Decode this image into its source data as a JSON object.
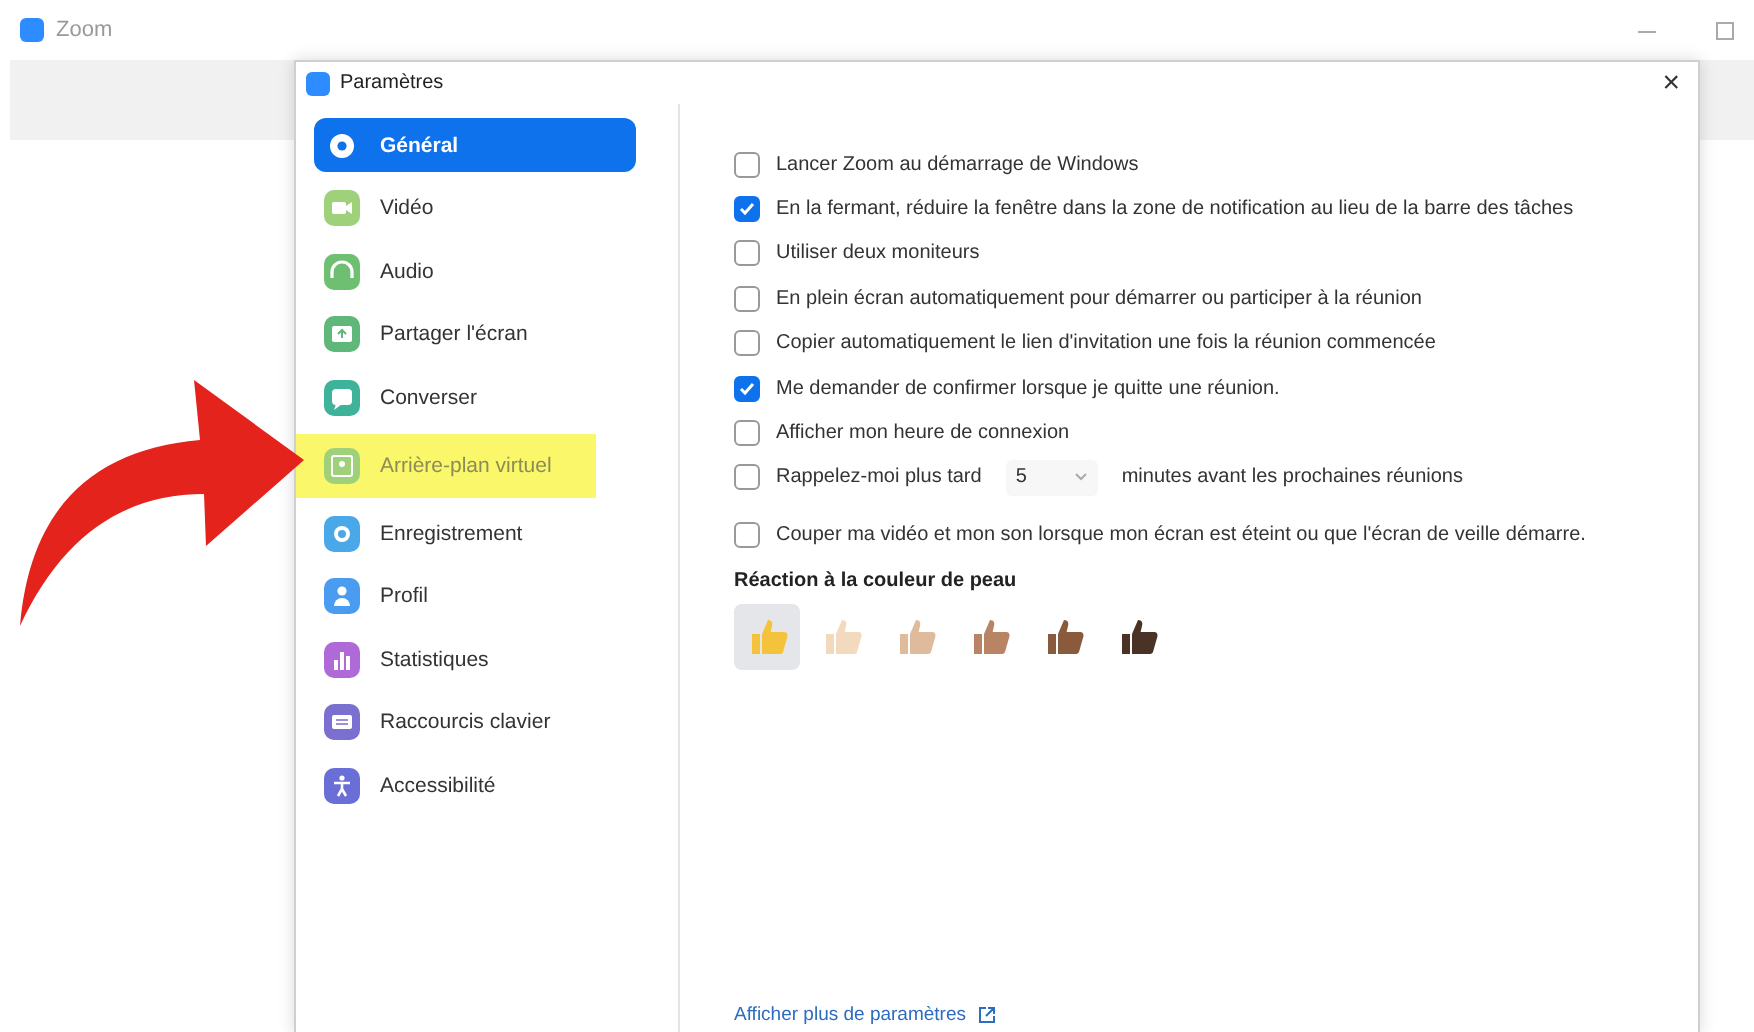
{
  "app_window": {
    "title": "Zoom"
  },
  "dialog": {
    "title": "Paramètres",
    "close": "×"
  },
  "sidebar": {
    "items": [
      {
        "label": "Général",
        "selected": true,
        "highlighted": false
      },
      {
        "label": "Vidéo",
        "selected": false,
        "highlighted": false
      },
      {
        "label": "Audio",
        "selected": false,
        "highlighted": false
      },
      {
        "label": "Partager l'écran",
        "selected": false,
        "highlighted": false
      },
      {
        "label": "Converser",
        "selected": false,
        "highlighted": false
      },
      {
        "label": "Arrière-plan virtuel",
        "selected": false,
        "highlighted": true
      },
      {
        "label": "Enregistrement",
        "selected": false,
        "highlighted": false
      },
      {
        "label": "Profil",
        "selected": false,
        "highlighted": false
      },
      {
        "label": "Statistiques",
        "selected": false,
        "highlighted": false
      },
      {
        "label": "Raccourcis clavier",
        "selected": false,
        "highlighted": false
      },
      {
        "label": "Accessibilité",
        "selected": false,
        "highlighted": false
      }
    ]
  },
  "options": [
    {
      "kind": "checkbox",
      "label": "Lancer Zoom au démarrage de Windows",
      "checked": false
    },
    {
      "kind": "checkbox",
      "label": "En la fermant, réduire la fenêtre dans la zone de notification au lieu de la barre des tâches",
      "checked": true
    },
    {
      "kind": "checkbox",
      "label": "Utiliser deux moniteurs",
      "checked": false
    },
    {
      "kind": "checkbox",
      "label": "En plein écran automatiquement pour démarrer ou participer à la réunion",
      "checked": false
    },
    {
      "kind": "checkbox",
      "label": "Copier automatiquement le lien d'invitation une fois la réunion commencée",
      "checked": false
    },
    {
      "kind": "checkbox",
      "label": "Me demander de confirmer lorsque je quitte une réunion.",
      "checked": true
    },
    {
      "kind": "checkbox",
      "label": "Afficher mon heure de connexion",
      "checked": false
    },
    {
      "kind": "reminder",
      "label": "Rappelez-moi plus tard",
      "checked": false,
      "value": "5",
      "suffix": "minutes avant les prochaines réunions"
    },
    {
      "kind": "checkbox_spaced",
      "label": "Couper ma vidéo et mon son lorsque mon écran est éteint ou que l'écran de veille démarre.",
      "checked": false
    }
  ],
  "skin_tone": {
    "heading": "Réaction à la couleur de peau",
    "tones": [
      {
        "color": "#f5c33b",
        "selected": true
      },
      {
        "color": "#f3d9bd",
        "selected": false
      },
      {
        "color": "#dfbb9c",
        "selected": false
      },
      {
        "color": "#b98463",
        "selected": false
      },
      {
        "color": "#8a5a3c",
        "selected": false
      },
      {
        "color": "#4a3326",
        "selected": false
      }
    ]
  },
  "more_link": "Afficher plus de paramètres"
}
